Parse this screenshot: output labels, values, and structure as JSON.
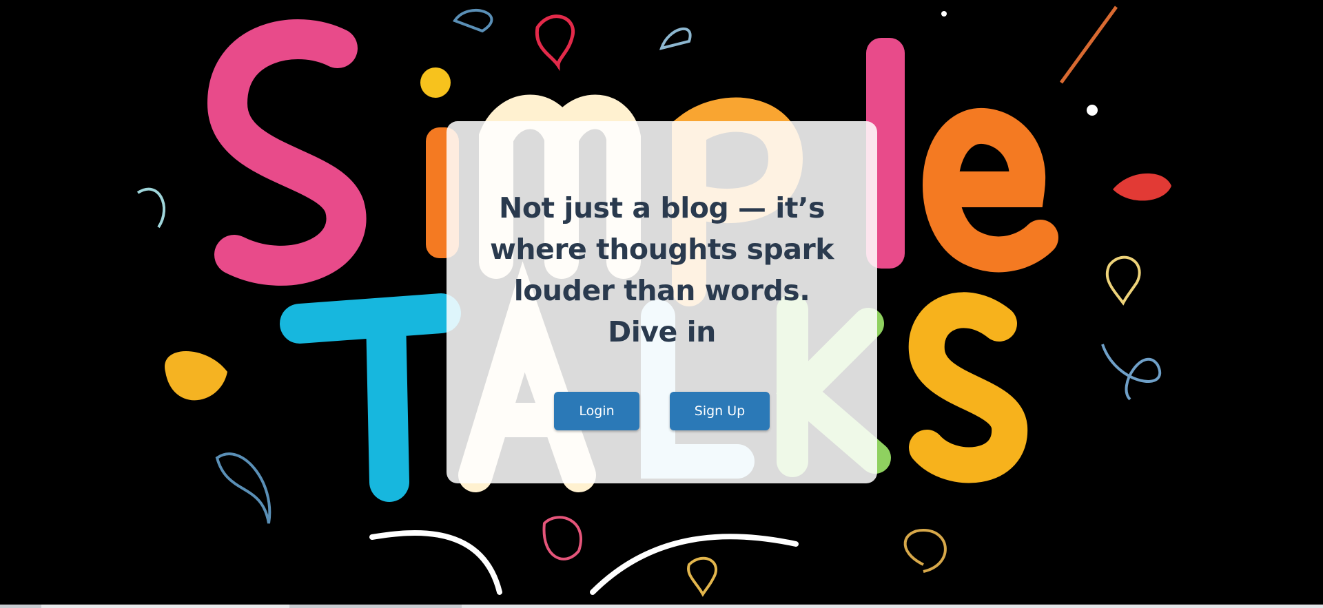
{
  "background": {
    "logo_text": "Simple TALKS",
    "colors": {
      "pink": "#e84b8a",
      "orange": "#f47a22",
      "cream": "#fff6dc",
      "cyan": "#17b7de",
      "green": "#7cc85a",
      "yellow": "#f7b21c"
    }
  },
  "hero": {
    "title": "Not just a blog — it’s where thoughts spark louder than words. Dive in",
    "login_label": "Login",
    "signup_label": "Sign Up",
    "card_color": "#ffffff",
    "title_color": "#2a3a4e",
    "button_color": "#2b79b7"
  }
}
